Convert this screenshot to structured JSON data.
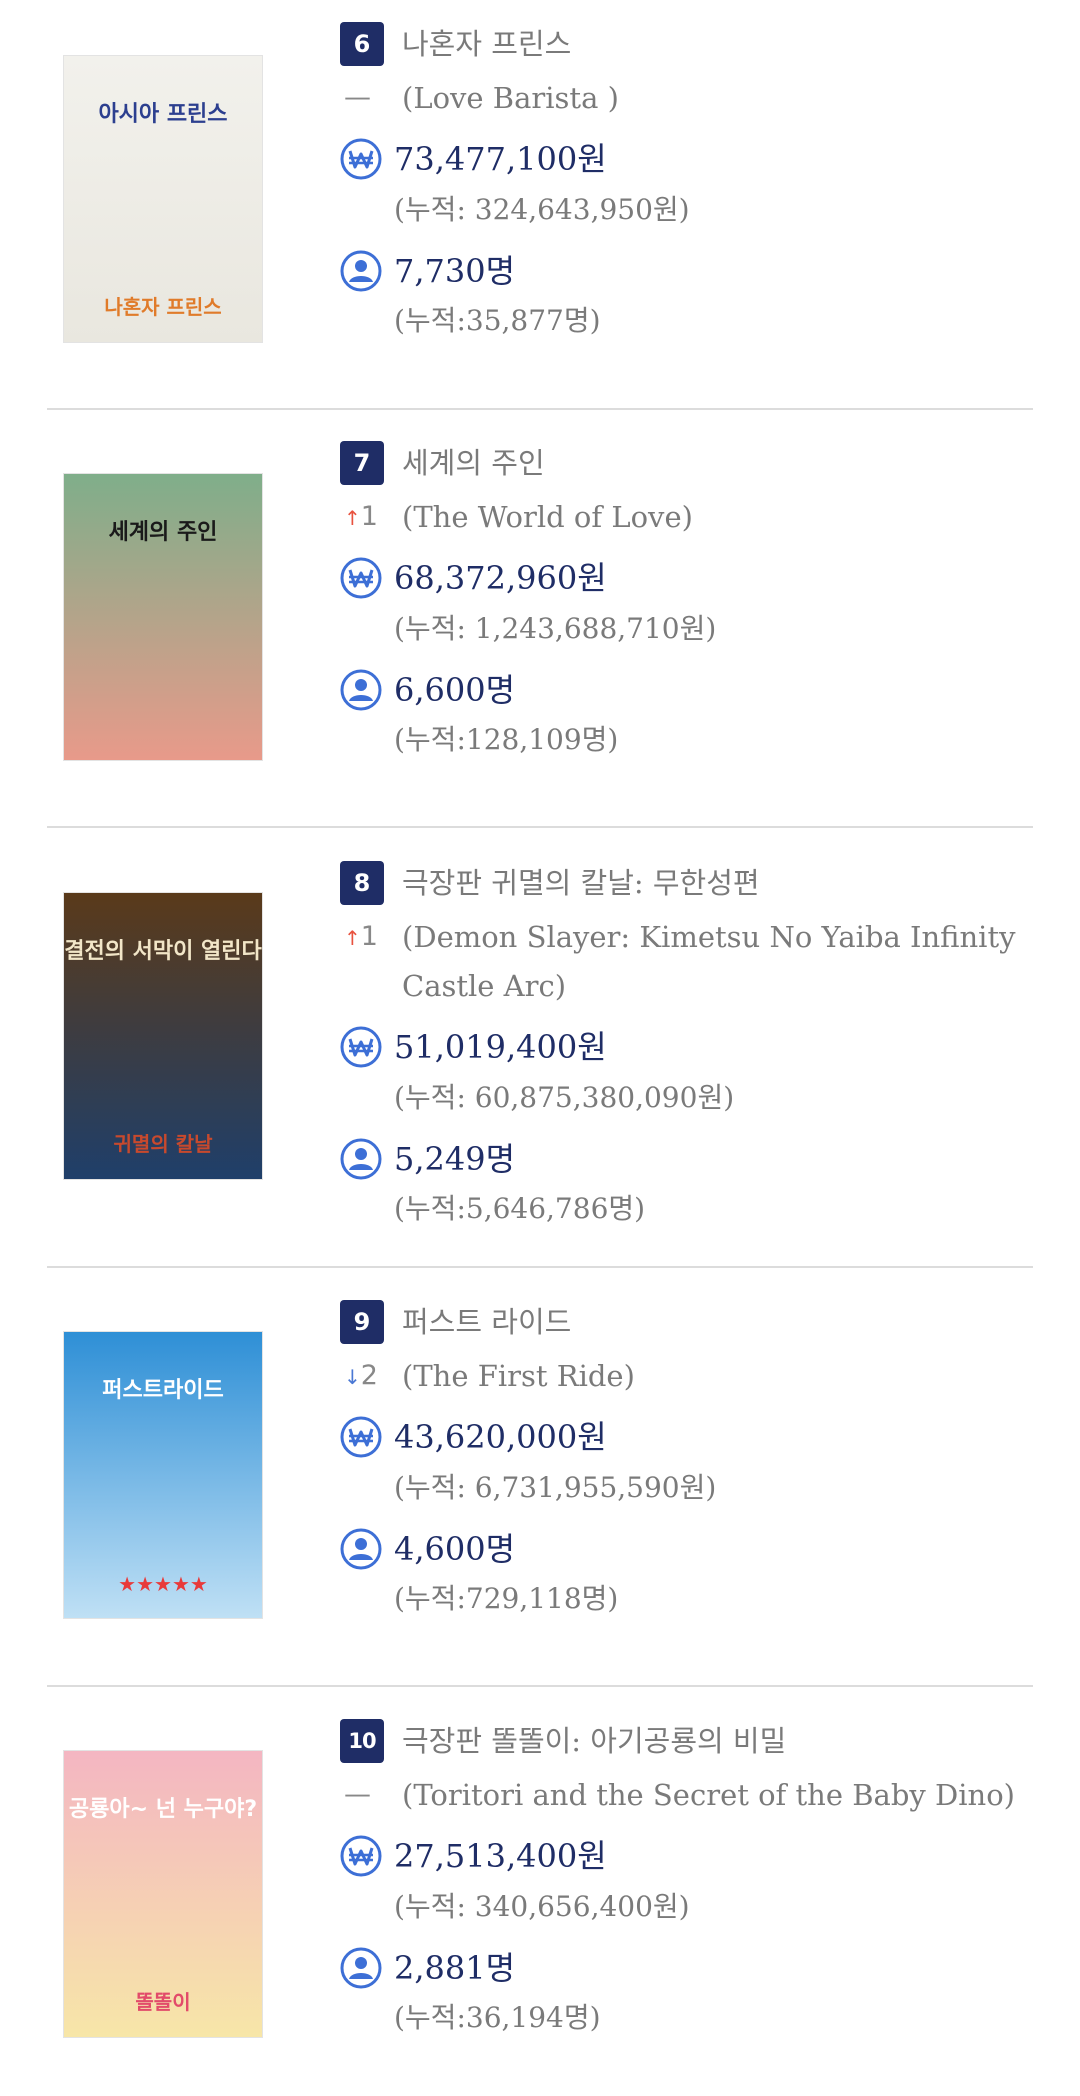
{
  "entries": [
    {
      "rank": "6",
      "title_ko": "나혼자 프린스",
      "change": "—",
      "change_dir": "same",
      "title_en": "(Love Barista )",
      "sales": "73,477,100원",
      "sales_cum": "(누적: 324,643,950원)",
      "audience": "7,730명",
      "audience_cum": "(누적:35,877명)",
      "poster": {
        "line1": "아시아 프린스",
        "line2": "나혼자 프린스",
        "colors": [
          "#f2f1ec",
          "#e9e7df"
        ],
        "text_color": "#2c3f8f",
        "accent": "#e07b2a"
      }
    },
    {
      "rank": "7",
      "title_ko": "세계의 주인",
      "change": "1",
      "change_dir": "up",
      "title_en": "(The World of Love)",
      "sales": "68,372,960원",
      "sales_cum": "(누적: 1,243,688,710원)",
      "audience": "6,600명",
      "audience_cum": "(누적:128,109명)",
      "poster": {
        "line1": "세계의 주인",
        "line2": "",
        "colors": [
          "#7fae8a",
          "#e89a8a"
        ],
        "text_color": "#1a1a1a",
        "accent": "#f0b9a6"
      }
    },
    {
      "rank": "8",
      "title_ko": "극장판 귀멸의 칼날: 무한성편",
      "change": "1",
      "change_dir": "up",
      "title_en": "(Demon Slayer: Kimetsu No Yaiba Infinity Castle Arc)",
      "sales": "51,019,400원",
      "sales_cum": "(누적: 60,875,380,090원)",
      "audience": "5,249명",
      "audience_cum": "(누적:5,646,786명)",
      "poster": {
        "line1": "결전의 서막이 열린다",
        "line2": "귀멸의 칼날",
        "colors": [
          "#5a3a1a",
          "#1f3f6a"
        ],
        "text_color": "#f2e6c8",
        "accent": "#c8492d"
      }
    },
    {
      "rank": "9",
      "title_ko": "퍼스트 라이드",
      "change": "2",
      "change_dir": "down",
      "title_en": "(The First Ride)",
      "sales": "43,620,000원",
      "sales_cum": "(누적: 6,731,955,590원)",
      "audience": "4,600명",
      "audience_cum": "(누적:729,118명)",
      "poster": {
        "line1": "퍼스트라이드",
        "line2": "★★★★★",
        "colors": [
          "#2e8fd6",
          "#bfe0f5"
        ],
        "text_color": "#ffffff",
        "accent": "#e83a3a"
      }
    },
    {
      "rank": "10",
      "title_ko": "극장판 똘똘이: 아기공룡의 비밀",
      "change": "—",
      "change_dir": "same",
      "title_en": "(Toritori and the Secret of the Baby Dino)",
      "sales": "27,513,400원",
      "sales_cum": "(누적: 340,656,400원)",
      "audience": "2,881명",
      "audience_cum": "(누적:36,194명)",
      "poster": {
        "line1": "공룡아~ 넌 누구야?",
        "line2": "똘똘이",
        "colors": [
          "#f4b6c2",
          "#f7e6a8"
        ],
        "text_color": "#ffffff",
        "accent": "#e24b6a"
      }
    }
  ],
  "icons": {
    "sales": "won-coin-icon",
    "audience": "person-icon",
    "up": "arrow-up-icon",
    "down": "arrow-down-icon"
  },
  "colors": {
    "rank_bg": "#1f2d66",
    "amount": "#1f2d66",
    "icon": "#3d6fd6",
    "up": "#e8523f",
    "down": "#4a78d4",
    "muted": "#7a7a7a"
  }
}
